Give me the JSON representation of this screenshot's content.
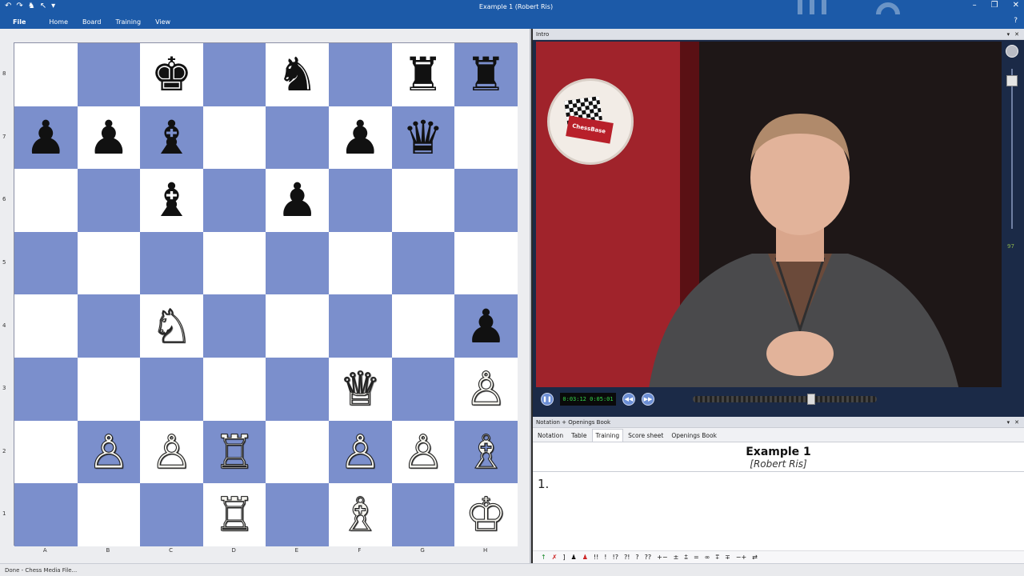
{
  "window": {
    "title": "Example 1  (Robert Ris)"
  },
  "ribbon": {
    "tabs": [
      "File",
      "Home",
      "Board",
      "Training",
      "View"
    ]
  },
  "board": {
    "ranks": [
      "8",
      "7",
      "6",
      "5",
      "4",
      "3",
      "2",
      "1"
    ],
    "files": [
      "A",
      "B",
      "C",
      "D",
      "E",
      "F",
      "G",
      "H"
    ],
    "rows": [
      [
        "",
        "",
        "♚",
        "",
        "♞",
        "",
        "♜",
        "♜"
      ],
      [
        "♟",
        "♟",
        "♝",
        "",
        "",
        "♟",
        "♛",
        ""
      ],
      [
        "",
        "",
        "♝",
        "",
        "♟",
        "",
        "",
        ""
      ],
      [
        "",
        "",
        "",
        "",
        "",
        "",
        "",
        ""
      ],
      [
        "",
        "",
        "♘",
        "",
        "",
        "",
        "",
        "♟"
      ],
      [
        "",
        "",
        "",
        "",
        "",
        "♕",
        "",
        "♙"
      ],
      [
        "",
        "♙",
        "♙",
        "♖",
        "",
        "♙",
        "♙",
        "♗"
      ],
      [
        "",
        "",
        "",
        "♖",
        "",
        "♗",
        "",
        "♔"
      ]
    ],
    "colors": [
      [
        "",
        "",
        "b",
        "",
        "b",
        "",
        "b",
        "b"
      ],
      [
        "b",
        "b",
        "b",
        "",
        "",
        "b",
        "b",
        ""
      ],
      [
        "",
        "",
        "b",
        "",
        "b",
        "",
        "",
        ""
      ],
      [
        "",
        "",
        "",
        "",
        "",
        "",
        "",
        ""
      ],
      [
        "",
        "",
        "w",
        "",
        "",
        "",
        "",
        "b"
      ],
      [
        "",
        "",
        "",
        "",
        "",
        "w",
        "",
        "w"
      ],
      [
        "",
        "w",
        "w",
        "w",
        "",
        "w",
        "w",
        "w"
      ],
      [
        "",
        "",
        "",
        "w",
        "",
        "w",
        "",
        "w"
      ]
    ]
  },
  "intro_panel": {
    "title": "Intro",
    "time_display": "0:03:12 0:05:01",
    "volume": "97",
    "progress_fraction": 0.65,
    "logo_text": "ChessBase"
  },
  "notation_panel": {
    "title": "Notation + Openings Book",
    "tabs": [
      "Notation",
      "Table",
      "Training",
      "Score sheet",
      "Openings Book"
    ],
    "active_tab": "Training",
    "game_title": "Example 1",
    "game_subtitle": "[Robert Ris]",
    "moves": "1.",
    "symbols": [
      "!!",
      "!",
      "!?",
      "?!",
      "?",
      "??",
      "+−",
      "±",
      "⩲",
      "=",
      "∞",
      "⩱",
      "∓",
      "−+",
      "⇄"
    ]
  },
  "status": {
    "text": "Done - Chess Media File..."
  }
}
